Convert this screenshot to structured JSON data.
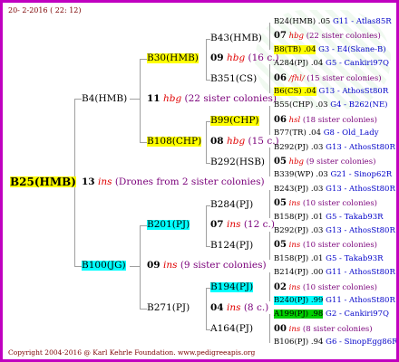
{
  "header": {
    "date": "20-  2-2016 ( 22: 12)"
  },
  "root": {
    "label": "B25(HMB)"
  },
  "gen1": {
    "count": "13",
    "code": "ins",
    "note": "(Drones from 2 sister colonies)"
  },
  "nodeB4": {
    "label": "B4(HMB)",
    "count": "11",
    "code": "hbg",
    "note": "(22 sister colonies)"
  },
  "nodeB100": {
    "label": "B100(JG)",
    "count": "09",
    "code": "ins",
    "note": "(9 sister colonies)"
  },
  "nodeB30": {
    "label": "B30(HMB)",
    "count": "09",
    "code": "hbg",
    "note": "(16 c.)"
  },
  "nodeB108": {
    "label": "B108(CHP)",
    "count": "08",
    "code": "hbg",
    "note": "(15 c.)"
  },
  "nodeB201": {
    "label": "B201(PJ)",
    "count": "07",
    "code": "ins",
    "note": "(12 c.)"
  },
  "nodeB271": {
    "label": "B271(PJ)",
    "count": "04",
    "code": "ins",
    "note": "(8 c.)"
  },
  "g3": [
    {
      "label": "B43(HMB)"
    },
    {
      "label": "B351(CS)"
    },
    {
      "label": "B99(CHP)"
    },
    {
      "label": "B292(HSB)"
    },
    {
      "label": "B284(PJ)"
    },
    {
      "label": "B124(PJ)"
    },
    {
      "label": "B194(PJ)"
    },
    {
      "label": "A164(PJ)"
    }
  ],
  "right": [
    {
      "label": "B24(HMB) .05",
      "tail": "G11 - Atlas85R"
    },
    {
      "count": "07",
      "code": "hbg",
      "note": "(22 sister colonies)"
    },
    {
      "label": "B8(TB) .04",
      "tail": "G3 - E4(Skane-B)"
    },
    {
      "label": "A284(PJ) .04",
      "tail": "G5 - Cankiri97Q"
    },
    {
      "count": "06",
      "code": "/fhl/",
      "note": "(15 sister colonies)"
    },
    {
      "label": "B6(CS) .04",
      "tail": "G13 - AthosSt80R"
    },
    {
      "label": "B55(CHP) .03",
      "tail": "G4 - B262(NE)"
    },
    {
      "count": "06",
      "code": "hsl",
      "note": "(18 sister colonies)"
    },
    {
      "label": "B77(TR) .04",
      "tail": "G8 - Old_Lady"
    },
    {
      "label": "B292(PJ) .03",
      "tail": "G13 - AthosSt80R"
    },
    {
      "count": "05",
      "code": "hbg",
      "note": "(9 sister colonies)"
    },
    {
      "label": "B339(WP) .03",
      "tail": "G21 - Sinop62R"
    },
    {
      "label": "B243(PJ) .03",
      "tail": "G13 - AthosSt80R"
    },
    {
      "count": "05",
      "code": "ins",
      "note": "(10 sister colonies)"
    },
    {
      "label": "B158(PJ) .01",
      "tail": "G5 - Takab93R"
    },
    {
      "label": "B292(PJ) .03",
      "tail": "G13 - AthosSt80R"
    },
    {
      "count": "05",
      "code": "ins",
      "note": "(10 sister colonies)"
    },
    {
      "label": "B158(PJ) .01",
      "tail": "G5 - Takab93R"
    },
    {
      "label": "B214(PJ) .00",
      "tail": "G11 - AthosSt80R"
    },
    {
      "count": "02",
      "code": "ins",
      "note": "(10 sister colonies)"
    },
    {
      "label": "B240(PJ) .99",
      "tail": "G11 - AthosSt80R"
    },
    {
      "label": "A199(PJ) .98",
      "tail": "G2 - Cankiri97Q"
    },
    {
      "count": "00",
      "code": "ins",
      "note": "(8 sister colonies)"
    },
    {
      "label": "B106(PJ) .94",
      "tail": "G6 - SinopEgg86R"
    }
  ],
  "footer": {
    "copyright": "Copyright 2004-2016 @ Karl Kehrle Foundation.",
    "site": "www.pedigreeapis.org"
  }
}
